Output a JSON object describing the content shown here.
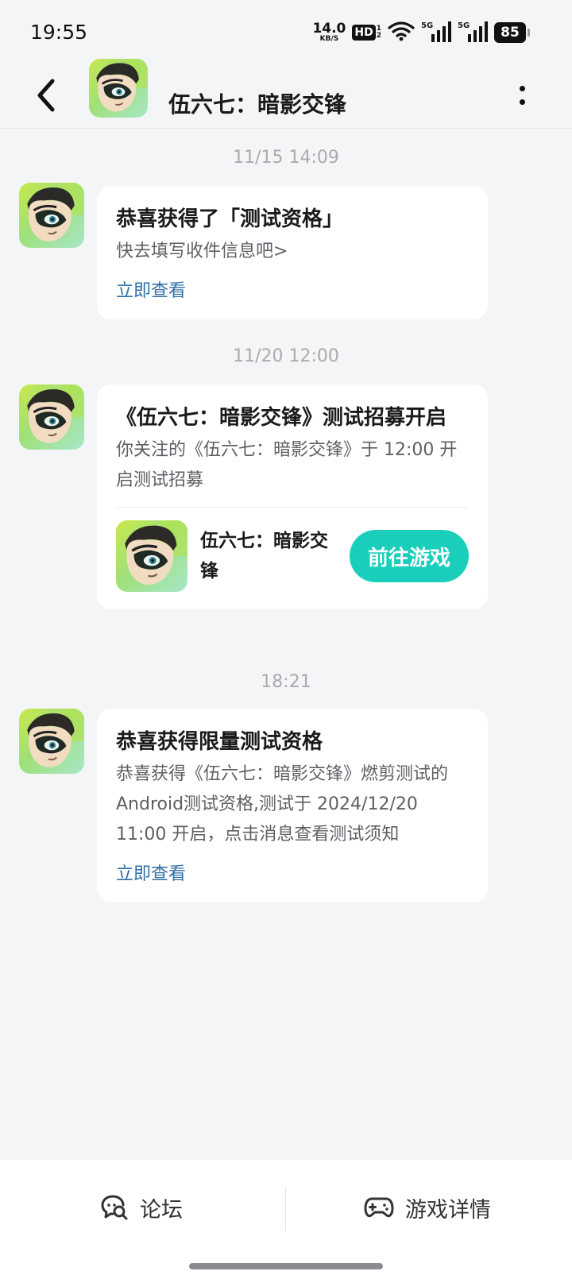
{
  "status_bar": {
    "time": "19:55",
    "net_speed_value": "14.0",
    "net_speed_unit": "KB/S",
    "hd_label": "HD",
    "hd_sub_top": "1",
    "hd_sub_bottom": "2",
    "signal1_tag": "5G",
    "signal2_tag": "5G",
    "battery": "85"
  },
  "header": {
    "title": "伍六七：暗影交锋"
  },
  "messages": [
    {
      "timestamp": "11/15  14:09",
      "title": "恭喜获得了「测试资格」",
      "body": "快去填写收件信息吧>",
      "link": "立即查看"
    },
    {
      "timestamp": "11/20  12:00",
      "title": "《伍六七：暗影交锋》测试招募开启",
      "body": "你关注的《伍六七：暗影交锋》于 12:00 开启测试招募",
      "game_name": "伍六七：暗影交锋",
      "button": "前往游戏"
    },
    {
      "timestamp": "18:21",
      "title": "恭喜获得限量测试资格",
      "body": "恭喜获得《伍六七：暗影交锋》燃剪测试的Android测试资格,测试于 2024/12/20 11:00 开启，点击消息查看测试须知",
      "link": "立即查看"
    }
  ],
  "bottom_bar": {
    "forum_label": "论坛",
    "forum_icon": "chat-search-icon",
    "details_label": "游戏详情",
    "details_icon": "gamepad-icon"
  },
  "colors": {
    "accent": "#19cfbb",
    "link": "#2e6fa8",
    "background": "#f4f5f7"
  }
}
